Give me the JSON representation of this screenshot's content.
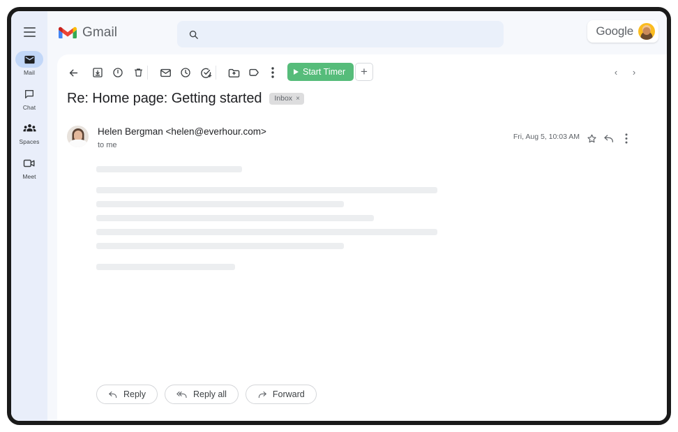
{
  "app": {
    "brand": "Gmail",
    "google_label": "Google"
  },
  "search": {
    "value": "",
    "placeholder": ""
  },
  "rail": {
    "menu_icon": "hamburger-menu-icon",
    "items": [
      {
        "label": "Mail",
        "icon": "mail-icon",
        "active": true
      },
      {
        "label": "Chat",
        "icon": "chat-icon",
        "active": false
      },
      {
        "label": "Spaces",
        "icon": "spaces-icon",
        "active": false
      },
      {
        "label": "Meet",
        "icon": "meet-icon",
        "active": false
      }
    ]
  },
  "toolbar": {
    "icons": [
      {
        "name": "back-icon",
        "title": "Back"
      },
      {
        "name": "archive-icon",
        "title": "Archive"
      },
      {
        "name": "report-spam-icon",
        "title": "Report spam"
      },
      {
        "name": "delete-icon",
        "title": "Delete"
      },
      {
        "name": "mark-unread-icon",
        "title": "Mark as unread"
      },
      {
        "name": "snooze-icon",
        "title": "Snooze"
      },
      {
        "name": "add-to-tasks-icon",
        "title": "Add to tasks"
      },
      {
        "name": "move-to-icon",
        "title": "Move to"
      },
      {
        "name": "labels-icon",
        "title": "Labels"
      },
      {
        "name": "more-options-icon",
        "title": "More"
      }
    ],
    "start_timer_label": "Start Timer",
    "start_timer_color": "#56bc7a",
    "add_timer_label": "+",
    "prev_label": "‹",
    "next_label": "›"
  },
  "message": {
    "subject": "Re: Home page: Getting started",
    "label_chip": "Inbox",
    "label_chip_close": "×",
    "sender": "Helen Bergman <helen@everhour.com>",
    "recipient": "to me",
    "date": "Fri, Aug 5, 10:03 AM",
    "star_icon": "star-icon",
    "reply_icon": "reply-icon",
    "more_icon": "more-options-icon",
    "body_placeholder_widths": [
      209,
      489,
      355,
      398,
      489,
      355,
      199
    ]
  },
  "actions": {
    "reply": "Reply",
    "reply_all": "Reply all",
    "forward": "Forward"
  }
}
